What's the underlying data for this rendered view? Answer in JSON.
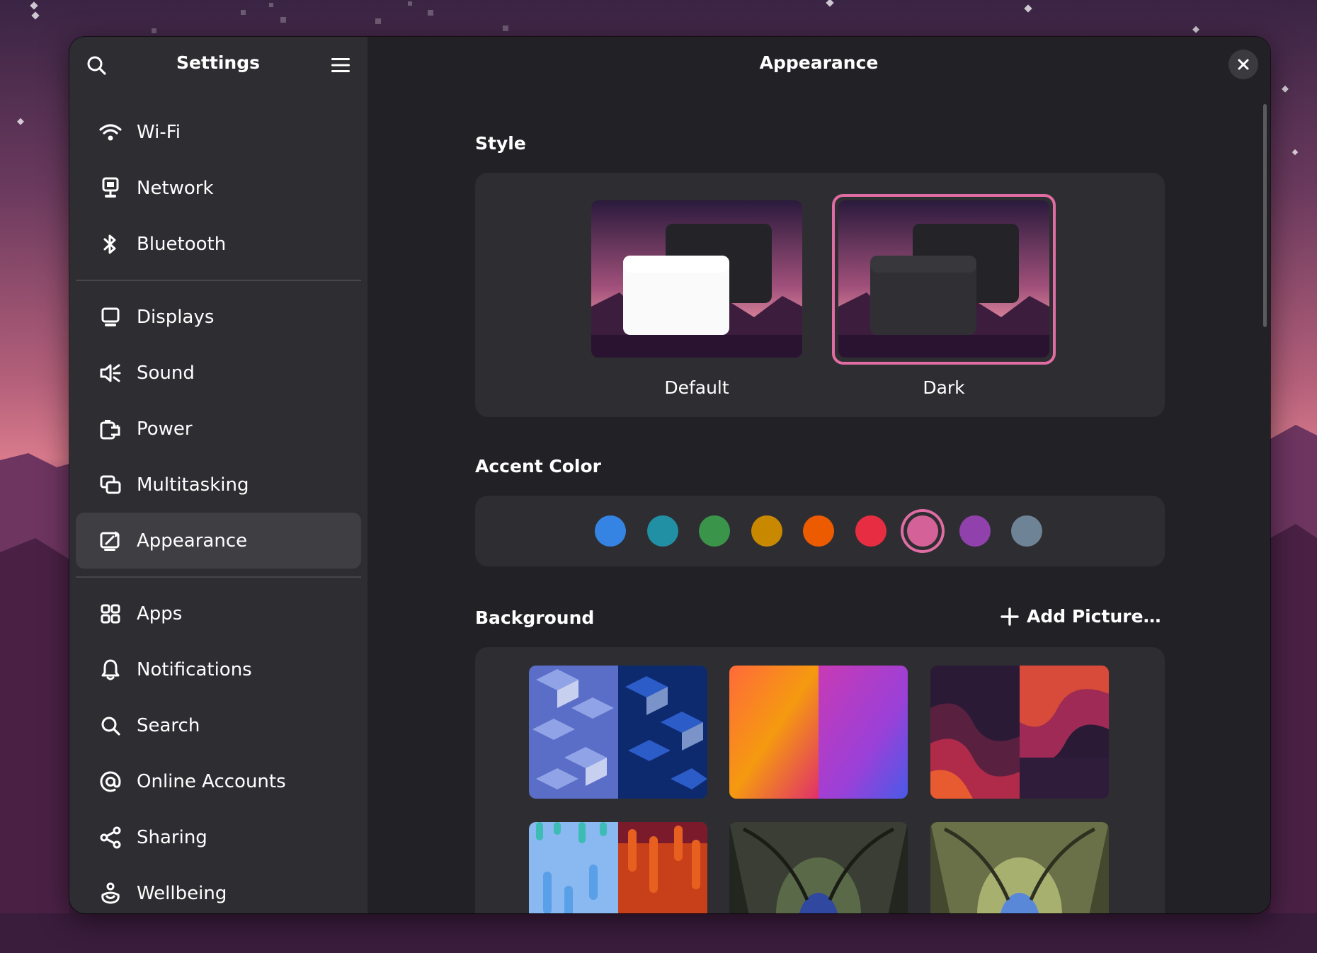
{
  "sidebar": {
    "title": "Settings",
    "groups": [
      [
        {
          "label": "Wi-Fi",
          "icon": "wifi-icon"
        },
        {
          "label": "Network",
          "icon": "network-icon"
        },
        {
          "label": "Bluetooth",
          "icon": "bluetooth-icon"
        }
      ],
      [
        {
          "label": "Displays",
          "icon": "display-icon"
        },
        {
          "label": "Sound",
          "icon": "sound-icon"
        },
        {
          "label": "Power",
          "icon": "power-icon"
        },
        {
          "label": "Multitasking",
          "icon": "multitasking-icon"
        },
        {
          "label": "Appearance",
          "icon": "appearance-icon",
          "active": true
        }
      ],
      [
        {
          "label": "Apps",
          "icon": "apps-icon"
        },
        {
          "label": "Notifications",
          "icon": "bell-icon"
        },
        {
          "label": "Search",
          "icon": "search-icon"
        },
        {
          "label": "Online Accounts",
          "icon": "at-icon"
        },
        {
          "label": "Sharing",
          "icon": "share-icon"
        },
        {
          "label": "Wellbeing",
          "icon": "wellbeing-icon"
        }
      ]
    ]
  },
  "content": {
    "title": "Appearance",
    "style": {
      "heading": "Style",
      "options": [
        {
          "label": "Default",
          "selected": false
        },
        {
          "label": "Dark",
          "selected": true
        }
      ]
    },
    "accent": {
      "heading": "Accent Color",
      "colors": [
        "#3584e4",
        "#2190a4",
        "#3a944a",
        "#c88800",
        "#ed5b00",
        "#e62d42",
        "#d56199",
        "#9141ac",
        "#6f8396"
      ],
      "selected_index": 6
    },
    "background": {
      "heading": "Background",
      "add_label": "Add Picture…",
      "thumbnails": [
        "blue-cubes",
        "orange-purple-gradient",
        "red-waves",
        "blue-orange-drips",
        "forest-tunnel-dark",
        "forest-tunnel-light"
      ]
    }
  },
  "colors": {
    "accent": "#e06ca4",
    "window_bg": "#222226",
    "sidebar_bg": "#2e2e32",
    "active_item_bg": "#3e3e43"
  }
}
